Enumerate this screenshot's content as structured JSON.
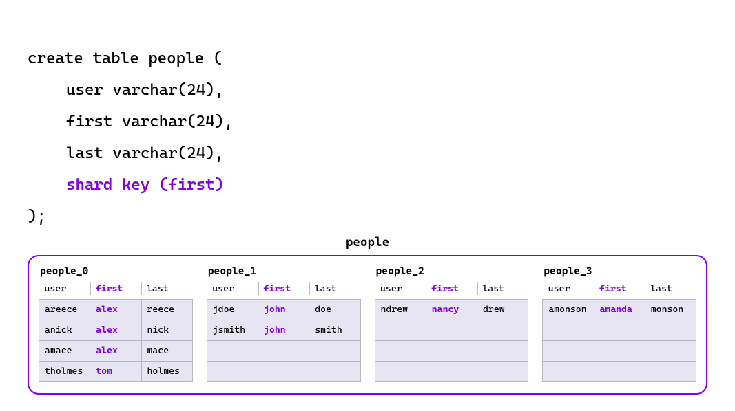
{
  "code": {
    "line1": "create table people (",
    "col_user": "user varchar(24),",
    "col_first": "first varchar(24),",
    "col_last": "last varchar(24),",
    "shard_key": "shard key (first)",
    "close": ");"
  },
  "diagram": {
    "title": "people",
    "columns": {
      "user": "user",
      "first": "first",
      "last": "last"
    },
    "row_count": 4,
    "shards": [
      {
        "name": "people_0",
        "rows": [
          {
            "user": "areece",
            "first": "alex",
            "last": "reece"
          },
          {
            "user": "anick",
            "first": "alex",
            "last": "nick"
          },
          {
            "user": "amace",
            "first": "alex",
            "last": "mace"
          },
          {
            "user": "tholmes",
            "first": "tom",
            "last": "holmes"
          }
        ]
      },
      {
        "name": "people_1",
        "rows": [
          {
            "user": "jdoe",
            "first": "john",
            "last": "doe"
          },
          {
            "user": "jsmith",
            "first": "john",
            "last": "smith"
          }
        ]
      },
      {
        "name": "people_2",
        "rows": [
          {
            "user": "ndrew",
            "first": "nancy",
            "last": "drew"
          }
        ]
      },
      {
        "name": "people_3",
        "rows": [
          {
            "user": "amonson",
            "first": "amanda",
            "last": "monson"
          }
        ]
      }
    ]
  }
}
